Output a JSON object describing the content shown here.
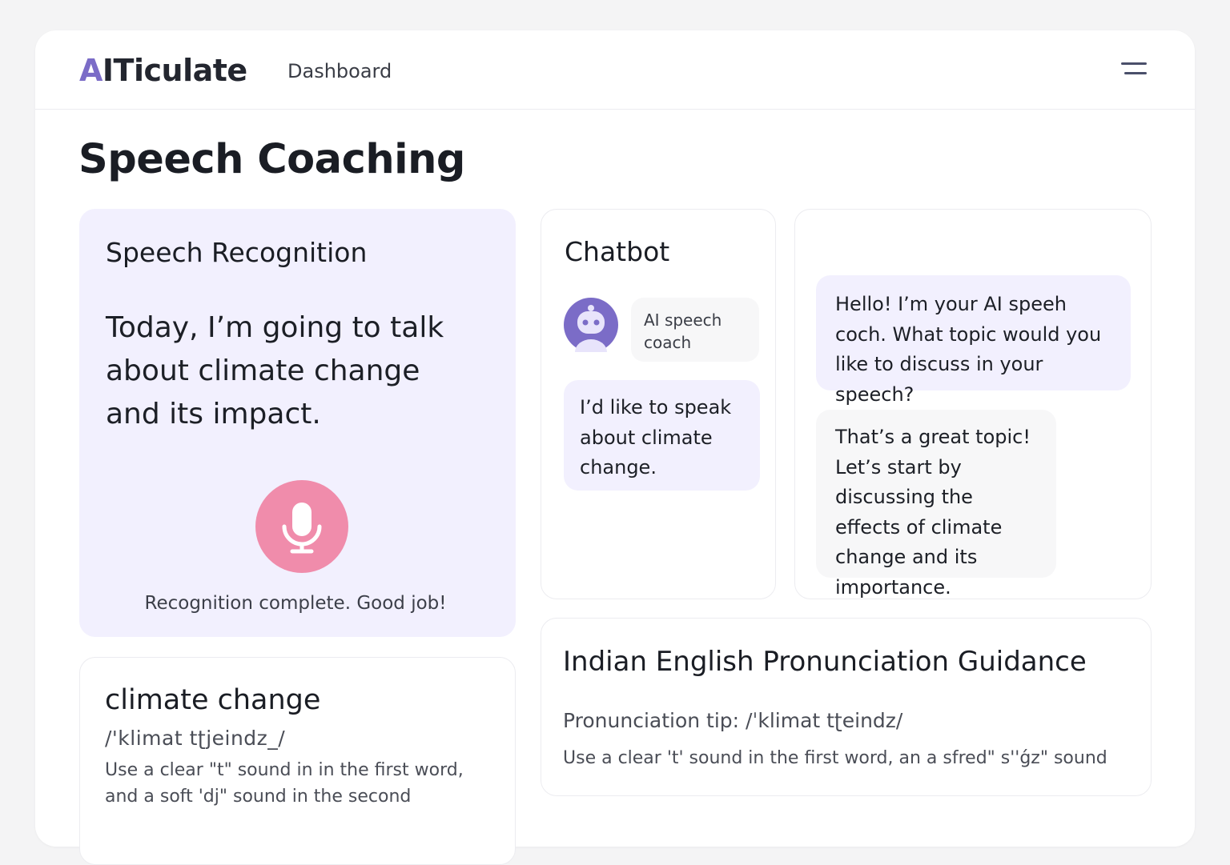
{
  "header": {
    "logo_accent": "A",
    "logo_rest": "ITiculate",
    "nav_dashboard": "Dashboard",
    "menu_icon": "menu-icon"
  },
  "page": {
    "title": "Speech Coaching"
  },
  "speech_recognition": {
    "title": "Speech Recognition",
    "transcript": "Today, I’m going to talk about climate change and its impact.",
    "mic_icon": "microphone-icon",
    "mic_color": "#f08cab",
    "status": "Recognition complete. Good job!"
  },
  "chatbot": {
    "title": "Chatbot",
    "avatar_icon": "robot-avatar-icon",
    "coach_label": "AI speech coach",
    "user_message": "I’d like to speak about climate change."
  },
  "conversation": {
    "messages": [
      "Hello! I’m your AI speeh coch. What topic would you like to discuss in your speech?",
      "That’s a great topic! Let’s start by discussing the effects of climate change and its importance."
    ]
  },
  "word_card": {
    "word": "climate change",
    "phonetic": "/'klimat  tʈjeindz_/",
    "tip": "Use a clear \"t\" sound in in the first word, and a soft 'dj\" sound in the second"
  },
  "guidance": {
    "title": "Indian English Pronunciation Guidance",
    "tip_label": "Pronunciation tip:",
    "tip_phonetic": "/ˈklimat  tʈeindz/",
    "tip_description": "Use a clear 't' sound in the first word, an a sfred\" s''ǵz\" sound"
  },
  "colors": {
    "accent": "#7b6cc7",
    "card_tint": "#f2f0fe",
    "background": "#f4f4f5"
  }
}
